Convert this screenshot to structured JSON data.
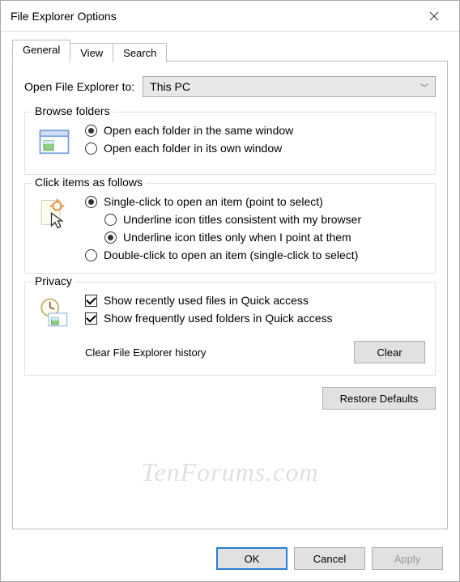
{
  "title": "File Explorer Options",
  "tabs": [
    "General",
    "View",
    "Search"
  ],
  "activeTab": 0,
  "openExplorer": {
    "label": "Open File Explorer to:",
    "value": "This PC"
  },
  "browseFolders": {
    "legend": "Browse folders",
    "opt1": "Open each folder in the same window",
    "opt2": "Open each folder in its own window",
    "selected": 0
  },
  "clickItems": {
    "legend": "Click items as follows",
    "single": "Single-click to open an item (point to select)",
    "underlineBrowser": "Underline icon titles consistent with my browser",
    "underlinePoint": "Underline icon titles only when I point at them",
    "double": "Double-click to open an item (single-click to select)"
  },
  "privacy": {
    "legend": "Privacy",
    "recent": "Show recently used files in Quick access",
    "frequent": "Show frequently used folders in Quick access",
    "clearLabel": "Clear File Explorer history",
    "clearBtn": "Clear"
  },
  "restore": "Restore Defaults",
  "buttons": {
    "ok": "OK",
    "cancel": "Cancel",
    "apply": "Apply"
  },
  "watermark": "TenForums.com"
}
